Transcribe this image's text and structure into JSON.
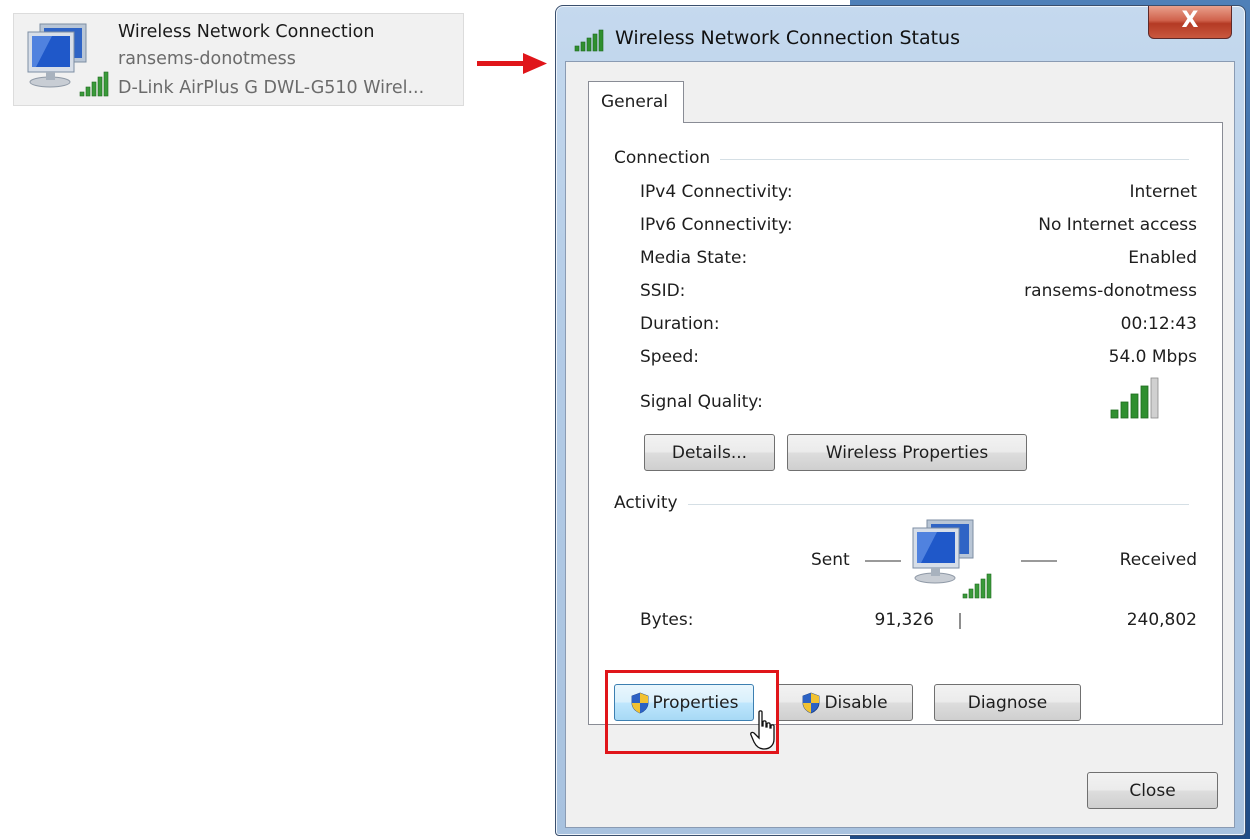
{
  "adapter": {
    "name": "Wireless Network Connection",
    "ssid": "ransems-donotmess",
    "device": "D-Link AirPlus G DWL-G510 Wirel...",
    "icon": "network-computers-icon"
  },
  "window": {
    "title": "Wireless Network Connection Status",
    "close_label": "X",
    "tab_general": "General",
    "connection": {
      "heading": "Connection",
      "rows": [
        {
          "label": "IPv4 Connectivity:",
          "value": "Internet"
        },
        {
          "label": "IPv6 Connectivity:",
          "value": "No Internet access"
        },
        {
          "label": "Media State:",
          "value": "Enabled"
        },
        {
          "label": "SSID:",
          "value": "ransems-donotmess"
        },
        {
          "label": "Duration:",
          "value": "00:12:43"
        },
        {
          "label": "Speed:",
          "value": "54.0 Mbps"
        }
      ],
      "signal_label": "Signal Quality:",
      "signal_bars_filled": 4,
      "signal_bars_total": 5,
      "details_button": "Details...",
      "wireless_properties_button": "Wireless Properties"
    },
    "activity": {
      "heading": "Activity",
      "sent_label": "Sent",
      "received_label": "Received",
      "bytes_label": "Bytes:",
      "bytes_sent": "91,326",
      "bytes_received": "240,802"
    },
    "buttons": {
      "properties": "Properties",
      "disable": "Disable",
      "diagnose": "Diagnose",
      "close": "Close"
    }
  },
  "colors": {
    "highlight": "#e0151a",
    "signal_green": "#2f8f2f",
    "arrow": "#e0151a"
  }
}
